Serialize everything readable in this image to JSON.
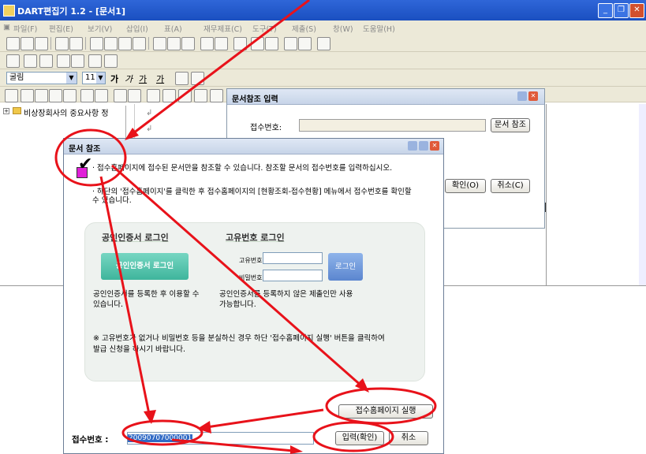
{
  "window": {
    "title": "DART편집기 1.2 - [문서1]"
  },
  "menubar": {
    "items": [
      "파일(F)",
      "편집(E)",
      "보기(V)",
      "삽입(I)",
      "표(A)",
      "재무제표(C)",
      "도구(T)",
      "제출(S)",
      "창(W)",
      "도움말(H)"
    ]
  },
  "format": {
    "font": "굴림",
    "size": "11",
    "bold": "가",
    "italic": "가",
    "underline": "가",
    "color": "가"
  },
  "tree": {
    "item": "비상장회사의 중요사항 정"
  },
  "dialog1": {
    "title": "문서참조 입력",
    "receipt_label": "접수번호:",
    "ref_button": "문서 참조",
    "ok_button": "확인(O)",
    "cancel_button": "취소(C)"
  },
  "dialog2": {
    "title": "문서 참조",
    "notice1": "· 접수홈페이지에 접수된 문서만을 참조할 수 있습니다.  참조할 문서의 접수번호를 입력하십시오.",
    "notice2": "· 하단의 '접수홈페이지'를 클릭한 후 접수홈페이지의 [현황조회-접수현황] 메뉴에서 접수번호를 확인할 수 있습니다.",
    "cert_heading": "공인인증서 로그인",
    "cert_button": "공인인증서 로그인",
    "cert_desc": "공인인증서를 등록한 후 이용할 수 있습니다.",
    "uid_heading": "고유번호 로그인",
    "uid_label": "고유번호",
    "pw_label": "비밀번호",
    "login_button": "로그인",
    "uid_desc": "공인인증서를 등록하지 않은 제출인만 사용 가능합니다.",
    "note": "※ 고유번호가 없거나 비밀번호 등을 분실하신 경우 하단 '접수홈페이지 실행' 버튼을 클릭하여 발급 신청을 하시기 바랍니다.",
    "homepage_button": "접수홈페이지 실행",
    "receipt_label": "접수번호 :",
    "receipt_value": "20090707000001",
    "confirm_button": "입력(확인)",
    "cancel_button": "취소"
  },
  "colors": {
    "annotation": "#e8121a",
    "title_bar": "#2456cc",
    "checkmark_box": "#e020d8"
  }
}
